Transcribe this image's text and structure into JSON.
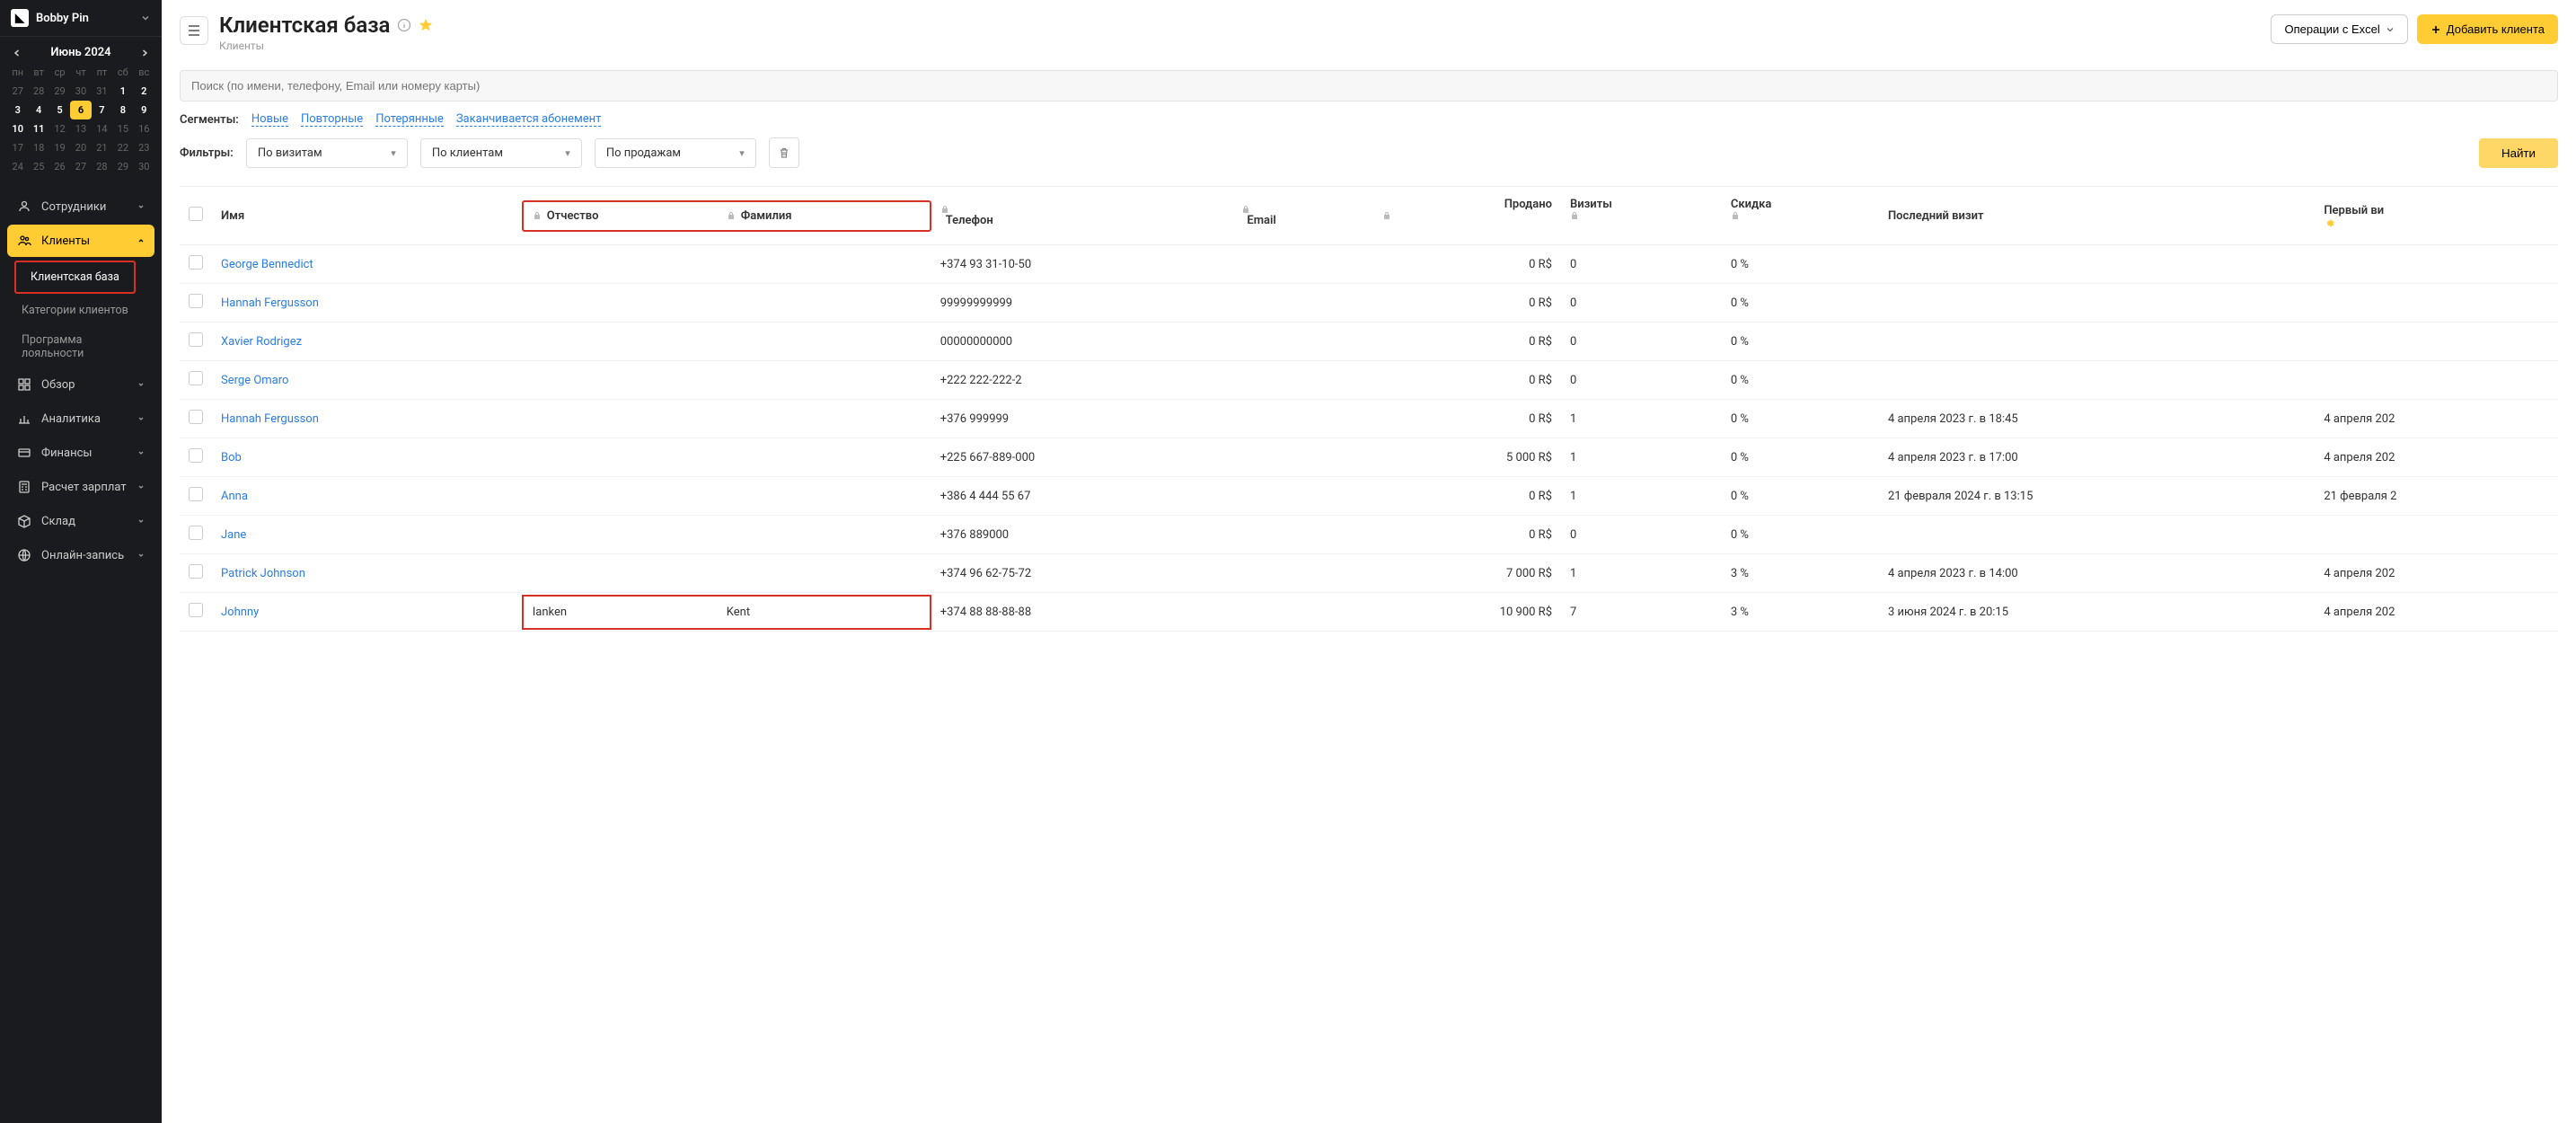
{
  "brand": "Bobby Pin",
  "calendar": {
    "title": "Июнь 2024",
    "dow": [
      "пн",
      "вт",
      "ср",
      "чт",
      "пт",
      "сб",
      "вс"
    ],
    "cells": [
      {
        "d": "27",
        "dim": true
      },
      {
        "d": "28",
        "dim": true
      },
      {
        "d": "29",
        "dim": true
      },
      {
        "d": "30",
        "dim": true
      },
      {
        "d": "31",
        "dim": true
      },
      {
        "d": "1",
        "cur": true
      },
      {
        "d": "2",
        "cur": true
      },
      {
        "d": "3",
        "cur": true
      },
      {
        "d": "4",
        "cur": true
      },
      {
        "d": "5",
        "cur": true
      },
      {
        "d": "6",
        "today": true
      },
      {
        "d": "7",
        "cur": true
      },
      {
        "d": "8",
        "cur": true
      },
      {
        "d": "9",
        "cur": true
      },
      {
        "d": "10",
        "cur": true
      },
      {
        "d": "11",
        "cur": true
      },
      {
        "d": "12"
      },
      {
        "d": "13"
      },
      {
        "d": "14"
      },
      {
        "d": "15"
      },
      {
        "d": "16"
      },
      {
        "d": "17"
      },
      {
        "d": "18"
      },
      {
        "d": "19"
      },
      {
        "d": "20"
      },
      {
        "d": "21"
      },
      {
        "d": "22"
      },
      {
        "d": "23"
      },
      {
        "d": "24"
      },
      {
        "d": "25"
      },
      {
        "d": "26"
      },
      {
        "d": "27"
      },
      {
        "d": "28"
      },
      {
        "d": "29"
      },
      {
        "d": "30"
      }
    ]
  },
  "nav": {
    "staff": "Сотрудники",
    "clients": "Клиенты",
    "clients_sub": {
      "db": "Клиентская база",
      "cats": "Категории клиентов",
      "loyalty": "Программа лояльности"
    },
    "overview": "Обзор",
    "analytics": "Аналитика",
    "finance": "Финансы",
    "payroll": "Расчет зарплат",
    "warehouse": "Склад",
    "online": "Онлайн-запись"
  },
  "page": {
    "title": "Клиентская база",
    "breadcrumb": "Клиенты",
    "excel": "Операции с Excel",
    "add": "Добавить клиента",
    "search_ph": "Поиск (по имени, телефону, Email или номеру карты)",
    "segments_label": "Сегменты:",
    "segments": [
      "Новые",
      "Повторные",
      "Потерянные",
      "Заканчивается абонемент"
    ],
    "filters_label": "Фильтры:",
    "filters": [
      "По визитам",
      "По клиентам",
      "По продажам"
    ],
    "find": "Найти"
  },
  "columns": {
    "name": "Имя",
    "patronymic": "Отчество",
    "surname": "Фамилия",
    "phone": "Телефон",
    "email": "Email",
    "sold": "Продано",
    "visits": "Визиты",
    "discount": "Скидка",
    "last": "Последний визит",
    "first": "Первый ви"
  },
  "rows": [
    {
      "name": "George Bennedict",
      "pat": "",
      "sur": "",
      "phone": "+374 93 31-10-50",
      "email": "",
      "sold": "0 R$",
      "visits": "0",
      "disc": "0 %",
      "last": "",
      "first": ""
    },
    {
      "name": "Hannah Fergusson",
      "pat": "",
      "sur": "",
      "phone": "99999999999",
      "email": "",
      "sold": "0 R$",
      "visits": "0",
      "disc": "0 %",
      "last": "",
      "first": ""
    },
    {
      "name": "Xavier Rodrigez",
      "pat": "",
      "sur": "",
      "phone": "00000000000",
      "email": "",
      "sold": "0 R$",
      "visits": "0",
      "disc": "0 %",
      "last": "",
      "first": ""
    },
    {
      "name": "Serge Omaro",
      "pat": "",
      "sur": "",
      "phone": "+222 222-222-2",
      "email": "",
      "sold": "0 R$",
      "visits": "0",
      "disc": "0 %",
      "last": "",
      "first": ""
    },
    {
      "name": "Hannah Fergusson",
      "pat": "",
      "sur": "",
      "phone": "+376 999999",
      "email": "",
      "sold": "0 R$",
      "visits": "1",
      "disc": "0 %",
      "last": "4 апреля 2023 г. в 18:45",
      "first": "4 апреля 202"
    },
    {
      "name": "Bob",
      "pat": "",
      "sur": "",
      "phone": "+225 667-889-000",
      "email": "",
      "sold": "5 000 R$",
      "visits": "1",
      "disc": "0 %",
      "last": "4 апреля 2023 г. в 17:00",
      "first": "4 апреля 202"
    },
    {
      "name": "Anna",
      "pat": "",
      "sur": "",
      "phone": "+386 4 444 55 67",
      "email": "",
      "sold": "0 R$",
      "visits": "1",
      "disc": "0 %",
      "last": "21 февраля 2024 г. в 13:15",
      "first": "21 февраля 2"
    },
    {
      "name": "Jane",
      "pat": "",
      "sur": "",
      "phone": "+376 889000",
      "email": "",
      "sold": "0 R$",
      "visits": "0",
      "disc": "0 %",
      "last": "",
      "first": ""
    },
    {
      "name": "Patrick Johnson",
      "pat": "",
      "sur": "",
      "phone": "+374 96 62-75-72",
      "email": "",
      "sold": "7 000 R$",
      "visits": "1",
      "disc": "3 %",
      "last": "4 апреля 2023 г. в 14:00",
      "first": "4 апреля 202"
    },
    {
      "name": "Johnny",
      "pat": "Ianken",
      "sur": "Kent",
      "phone": "+374 88 88-88-88",
      "email": "",
      "sold": "10 900 R$",
      "visits": "7",
      "disc": "3 %",
      "last": "3 июня 2024 г. в 20:15",
      "first": "4 апреля 202",
      "hl": true
    }
  ]
}
